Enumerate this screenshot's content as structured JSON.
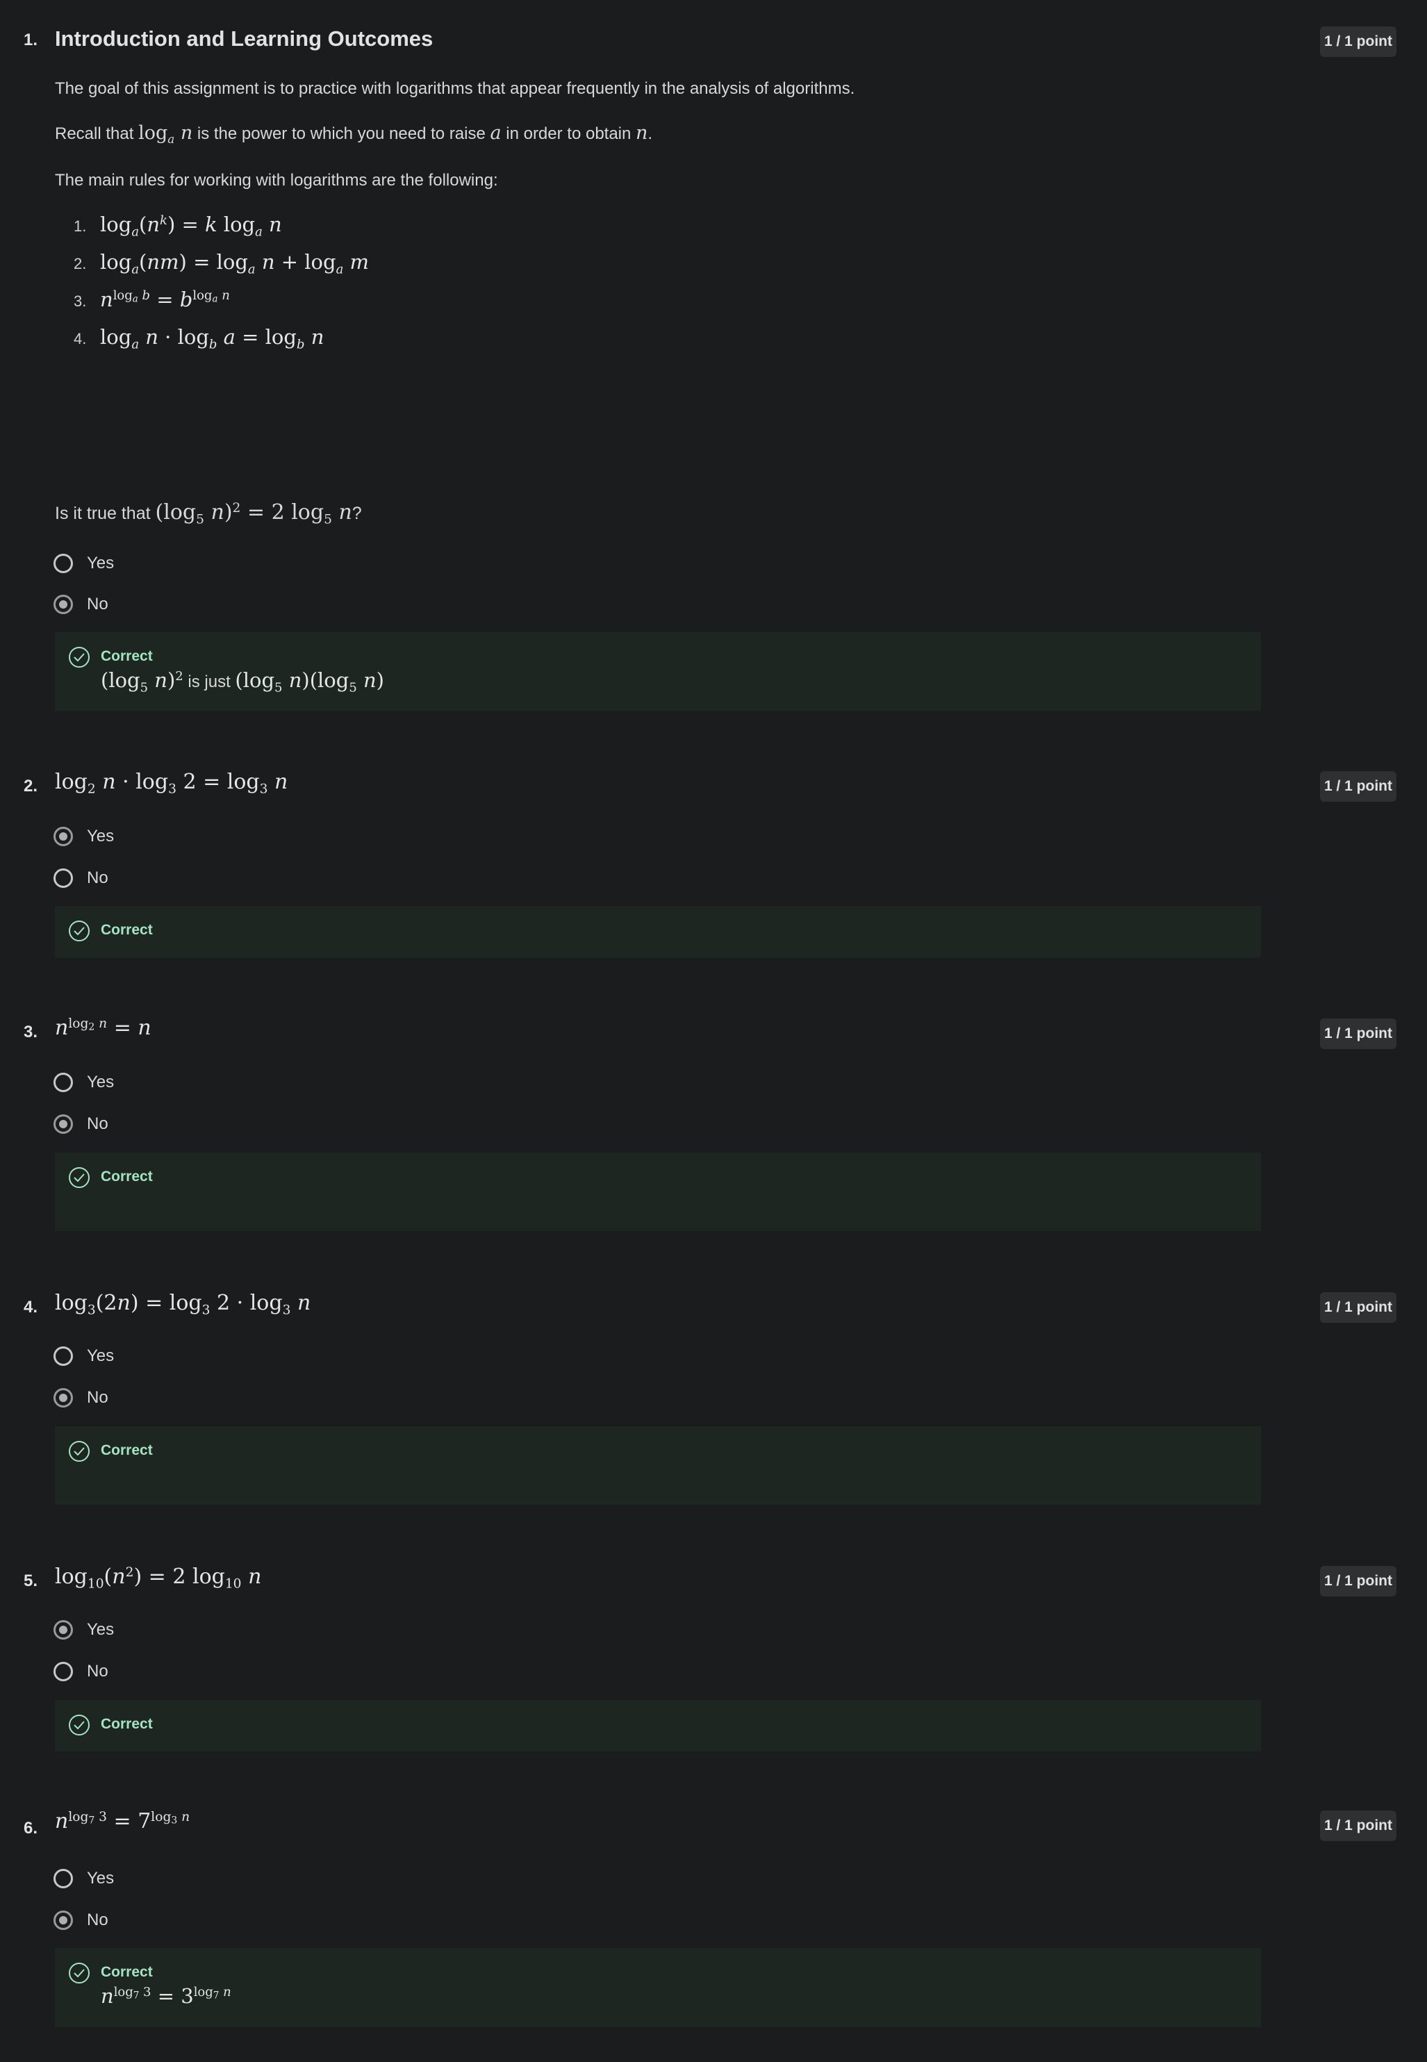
{
  "points_label": "1 / 1 point",
  "correct_label": "Correct",
  "options": {
    "yes": "Yes",
    "no": "No"
  },
  "intro": {
    "number": "1.",
    "title": "Introduction and Learning Outcomes",
    "goal": "The goal of this assignment is to practice with logarithms that appear frequently in the analysis of algorithms.",
    "recall_prefix": "Recall that ",
    "recall_mid": " is the power to which you need to raise ",
    "recall_mid2": " in order to obtain ",
    "recall_end": ".",
    "rules_intro": "The main rules for working with logarithms are the following:",
    "rule_numbers": [
      "1.",
      "2.",
      "3.",
      "4."
    ],
    "question_prefix": "Is it true that ",
    "question_suffix": "?",
    "selected": "no",
    "explanation_mid": " is just "
  },
  "questions": [
    {
      "number": "2.",
      "selected": "yes"
    },
    {
      "number": "3.",
      "selected": "no"
    },
    {
      "number": "4.",
      "selected": "no"
    },
    {
      "number": "5.",
      "selected": "yes"
    },
    {
      "number": "6.",
      "selected": "no"
    }
  ],
  "colors": {
    "background": "#1b1c1e",
    "feedback_bg": "#1d2621",
    "correct_green": "#a5e4c3",
    "badge_bg": "#2e3032"
  },
  "icons": {
    "correct": "check-circle-icon"
  }
}
